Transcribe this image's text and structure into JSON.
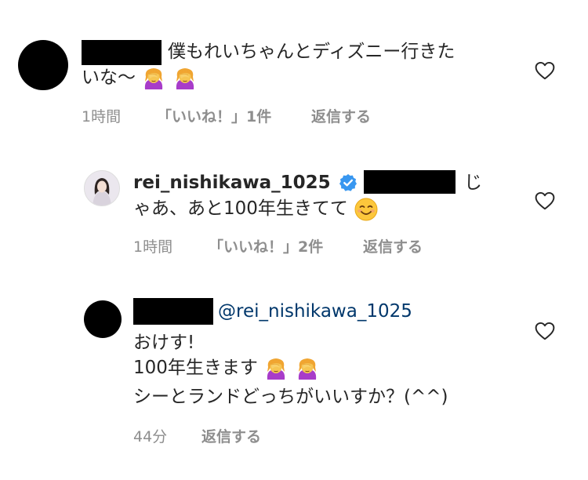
{
  "comments": [
    {
      "line1": "僕もれいちゃんとディズニー行きた",
      "line2": "いな〜",
      "emoji_names": [
        "facepalm-woman-emoji",
        "facepalm-woman-emoji"
      ],
      "meta": {
        "time": "1時間",
        "likes": "「いいね！」1件",
        "reply": "返信する"
      }
    },
    {
      "username": "rei_nishikawa_1025",
      "line1_tail": "じ",
      "line2": "ゃあ、あと100年生きてて",
      "emoji_names": [
        "smiling-face-emoji"
      ],
      "meta": {
        "time": "1時間",
        "likes": "「いいね！」2件",
        "reply": "返信する"
      }
    },
    {
      "mention": "@rei_nishikawa_1025",
      "line1": "おけす!",
      "line2": "100年生きます",
      "line3": "シーとランドどっちがいいすか？(^^)",
      "emoji_names": [
        "facepalm-woman-emoji",
        "facepalm-woman-emoji"
      ],
      "meta": {
        "time": "44分",
        "reply": "返信する"
      }
    }
  ],
  "icons": {
    "like": "heart-outline-icon",
    "verified": "verified-badge-icon"
  },
  "colors": {
    "text": "#262626",
    "meta": "#8e8e8e",
    "mention": "#00376b",
    "verified": "#3897f0"
  }
}
